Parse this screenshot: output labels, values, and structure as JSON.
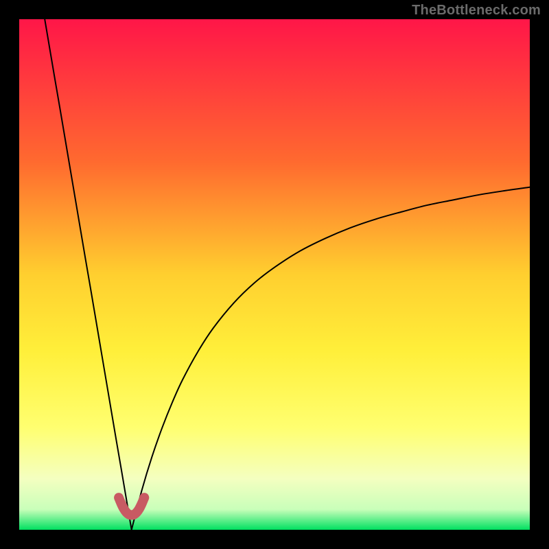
{
  "watermark": "TheBottleneck.com",
  "colors": {
    "frame": "#000000",
    "grad_top": "#ff1648",
    "grad_mid_upper": "#ff8a2a",
    "grad_mid": "#ffe63a",
    "grad_mid_lower": "#ffff6a",
    "grad_lower": "#f6ffb0",
    "grad_bottom": "#00e060",
    "curve": "#000000",
    "thick_segment": "#c85a63"
  },
  "chart_data": {
    "type": "line",
    "title": "",
    "xlabel": "",
    "ylabel": "",
    "xlim": [
      0,
      100
    ],
    "ylim": [
      0,
      100
    ],
    "grid": false,
    "legend": false,
    "minimum_x": 22,
    "series": [
      {
        "name": "left-branch",
        "x": [
          5,
          6,
          7,
          8,
          9,
          10,
          11,
          12,
          13,
          14,
          15,
          16,
          17,
          18,
          19,
          20,
          21,
          22
        ],
        "values": [
          100,
          94.1,
          88.2,
          82.4,
          76.5,
          70.6,
          64.7,
          58.8,
          52.9,
          47.1,
          41.2,
          35.3,
          29.4,
          23.5,
          17.6,
          11.8,
          5.9,
          0
        ]
      },
      {
        "name": "right-branch",
        "x": [
          22,
          24,
          26,
          28,
          30,
          32,
          35,
          38,
          42,
          46,
          50,
          55,
          60,
          65,
          70,
          75,
          80,
          85,
          90,
          95,
          100
        ],
        "values": [
          0,
          7.7,
          14.3,
          20.0,
          25.0,
          29.4,
          34.9,
          39.5,
          44.4,
          48.3,
          51.4,
          54.6,
          57.1,
          59.2,
          60.9,
          62.3,
          63.6,
          64.6,
          65.6,
          66.4,
          67.1
        ]
      },
      {
        "name": "valley-highlight",
        "x": [
          19.5,
          20,
          20.5,
          21,
          21.5,
          22,
          22.5,
          23,
          23.5,
          24,
          24.5
        ],
        "values": [
          6.3,
          5.1,
          4.1,
          3.4,
          3.0,
          2.9,
          3.0,
          3.4,
          4.1,
          5.1,
          6.3
        ]
      }
    ]
  }
}
